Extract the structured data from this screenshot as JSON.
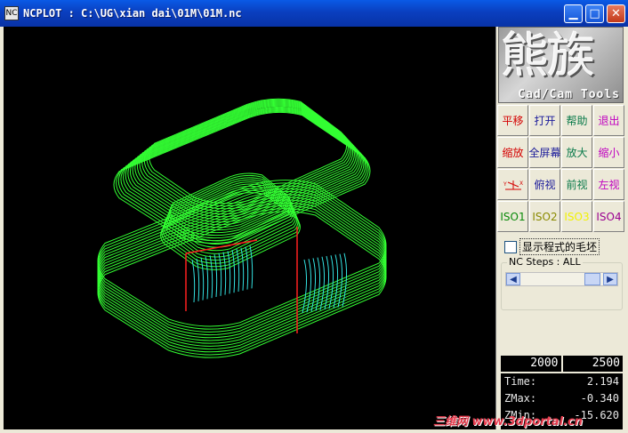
{
  "window": {
    "title": "NCPLOT : C:\\UG\\xian dai\\01M\\01M.nc",
    "app_icon_glyph": "NC",
    "min_glyph": "▁",
    "max_glyph": "□",
    "close_glyph": "✕"
  },
  "logo": {
    "chars": "熊族",
    "subtitle": "Cad/Cam Tools"
  },
  "toolbar": {
    "buttons": [
      {
        "label": "平移",
        "color": "#d40000"
      },
      {
        "label": "打开",
        "color": "#1a1a9a"
      },
      {
        "label": "帮助",
        "color": "#0a7a4a"
      },
      {
        "label": "退出",
        "color": "#c000c0"
      },
      {
        "label": "缩放",
        "color": "#d40000"
      },
      {
        "label": "全屏幕",
        "color": "#1a1a9a"
      },
      {
        "label": "放大",
        "color": "#0a7a4a"
      },
      {
        "label": "缩小",
        "color": "#c000c0"
      },
      {
        "label": "",
        "icon": "axes-icon",
        "color": "#d40000"
      },
      {
        "label": "俯视",
        "color": "#1a1a9a"
      },
      {
        "label": "前视",
        "color": "#0a7a4a"
      },
      {
        "label": "左视",
        "color": "#c000c0"
      },
      {
        "label": "ISO1",
        "color": "#0a8a0a"
      },
      {
        "label": "ISO2",
        "color": "#8a8a00"
      },
      {
        "label": "ISO3",
        "color": "#f2f200"
      },
      {
        "label": "ISO4",
        "color": "#9a0090"
      }
    ]
  },
  "options": {
    "show_stock_label": "显示程式的毛坯",
    "show_stock_checked": false
  },
  "nc_steps": {
    "label": "NC Steps : ALL",
    "left_arrow": "◀",
    "right_arrow": "▶"
  },
  "steps": {
    "start": "2000",
    "end": "2500"
  },
  "readout": {
    "time_label": "Time:",
    "time_value": "2.194",
    "zmax_label": "ZMax:",
    "zmax_value": "-0.340",
    "zmin_label": "ZMin:",
    "zmin_value": "-15.620"
  },
  "watermark": "三维网 www.3dportal.cn",
  "colors": {
    "toolpath": "#33ff33",
    "cut_red": "#ff2020",
    "cut_cyan": "#33e0e0",
    "viewport_bg": "#000000"
  }
}
